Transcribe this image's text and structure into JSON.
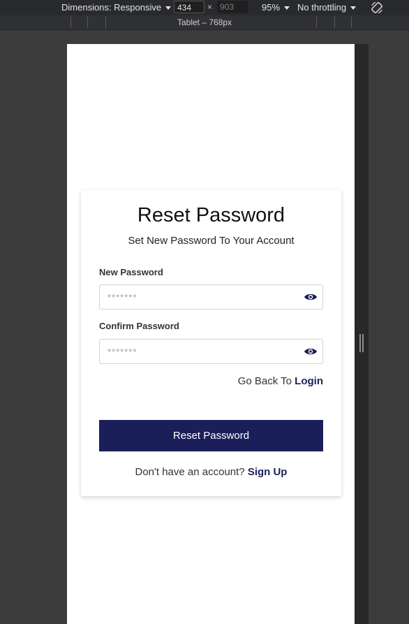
{
  "devtools": {
    "dimensions_label": "Dimensions: Responsive",
    "width_value": "434",
    "height_value": "903",
    "times_symbol": "×",
    "zoom": "95%",
    "throttling": "No throttling",
    "media_query_label": "Tablet – 768px"
  },
  "form": {
    "title": "Reset Password",
    "subtitle": "Set New Password To Your Account",
    "new_password_label": "New Password",
    "new_password_placeholder": "*******",
    "confirm_password_label": "Confirm Password",
    "confirm_password_placeholder": "*******",
    "go_back_text": "Go Back To ",
    "login_link": "Login",
    "submit_label": "Reset Password",
    "signup_prompt": "Don't have an account? ",
    "signup_link": "Sign Up"
  },
  "icons": {
    "password_toggle": "eye-icon",
    "rotate": "rotate-icon"
  },
  "colors": {
    "primary": "#1b1f59",
    "toolbar_bg": "#292a2d",
    "canvas_bg": "#3c3c3c"
  }
}
